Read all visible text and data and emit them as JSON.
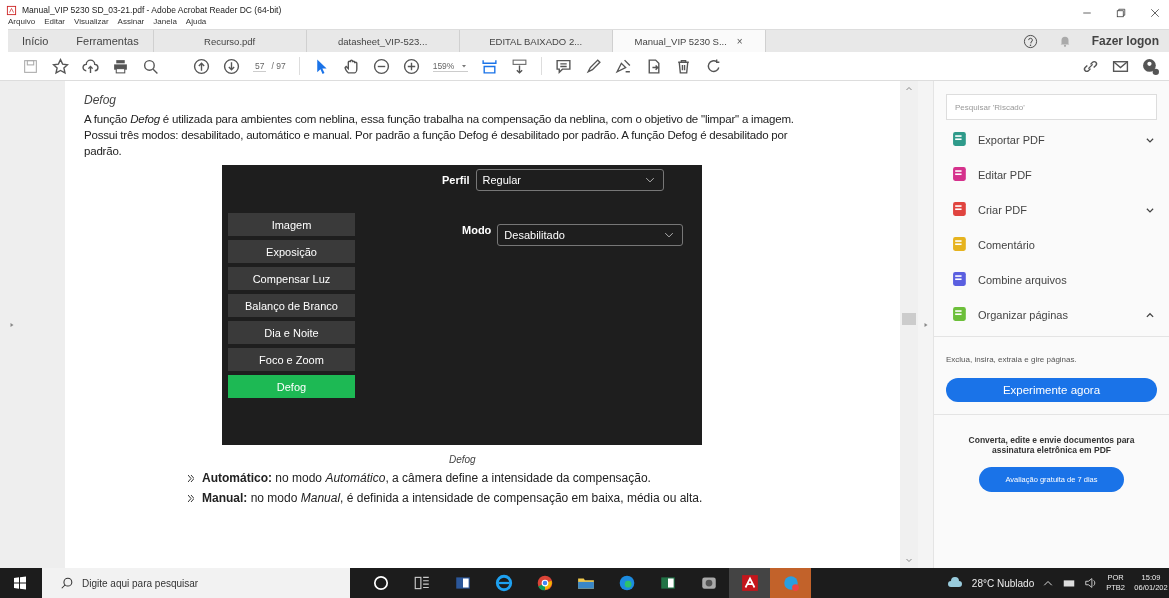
{
  "window": {
    "title": "Manual_VIP 5230 SD_03-21.pdf - Adobe Acrobat Reader DC (64-bit)"
  },
  "menu": [
    "Arquivo",
    "Editar",
    "Visualizar",
    "Assinar",
    "Janela",
    "Ajuda"
  ],
  "nav_tabs": [
    {
      "label": "Início",
      "selected": false
    },
    {
      "label": "Ferramentas",
      "selected": false
    }
  ],
  "doc_tabs": [
    {
      "label": "Recurso.pdf",
      "selected": false
    },
    {
      "label": "datasheet_VIP-523...",
      "selected": false
    },
    {
      "label": "EDITAL BAIXADO 2...",
      "selected": false
    },
    {
      "label": "Manual_VIP 5230 S...",
      "selected": true,
      "close": "×"
    }
  ],
  "account": {
    "label": "Fazer logon"
  },
  "toolbar": {
    "page": "57",
    "page_total": "/ 97",
    "zoom": "159%"
  },
  "document": {
    "heading": "Defog",
    "paragraph": "A função *Defog* é utilizada para ambientes com neblina, essa função trabalha na compensação da neblina, com o objetivo de \"limpar\" a imagem. Possui três modos: desabilitado, automático e manual. Por padrão a função Defog é desabilitado por padrão. A função Defog é desabilitado por padrão.",
    "figure": {
      "profile_label": "Perfil",
      "profile_value": "Regular",
      "mode_label": "Modo",
      "mode_value": "Desabilitado",
      "menu": [
        {
          "label": "Imagem",
          "selected": false
        },
        {
          "label": "Exposição",
          "selected": false
        },
        {
          "label": "Compensar Luz",
          "selected": false
        },
        {
          "label": "Balanço de Branco",
          "selected": false
        },
        {
          "label": "Dia e Noite",
          "selected": false
        },
        {
          "label": "Foco e Zoom",
          "selected": false
        },
        {
          "label": "Defog",
          "selected": true
        }
      ]
    },
    "caption": "Defog",
    "bullets": [
      "**Automático:** no modo *Automático*, a câmera define a intensidade da compensação.",
      "**Manual:** no modo *Manual*, é definida a intensidade de compensação em baixa, média ou alta."
    ]
  },
  "sidebar": {
    "search": {
      "placeholder": "Pesquisar 'Riscado'"
    },
    "tools": [
      {
        "label": "Exportar PDF",
        "color": "#2e9a8a",
        "kind": "expandable",
        "expanded": false
      },
      {
        "label": "Editar PDF",
        "color": "#d5318c",
        "kind": "plain",
        "expanded": false
      },
      {
        "label": "Criar PDF",
        "color": "#e0443f",
        "kind": "expandable",
        "expanded": false
      },
      {
        "label": "Comentário",
        "color": "#e6b31e",
        "kind": "plain",
        "expanded": false
      },
      {
        "label": "Combine arquivos",
        "color": "#5a5fe0",
        "kind": "plain",
        "expanded": false
      },
      {
        "label": "Organizar páginas",
        "color": "#6cbf3a",
        "kind": "expandable",
        "expanded": true
      }
    ],
    "description": "Exclua, insira, extraia e gire páginas.",
    "button": "Experimente agora",
    "promo": "Converta, edite e envie documentos para assinatura eletrônica em PDF",
    "promo_button": "Avaliação gratuita de 7 dias"
  },
  "taskbar": {
    "search": {
      "placeholder": "Digite aqui para pesquisar"
    },
    "weather": "28°C Nublado",
    "lang": "POR",
    "layout": "PTB2",
    "time": "15:09",
    "date": "06/01/202"
  }
}
